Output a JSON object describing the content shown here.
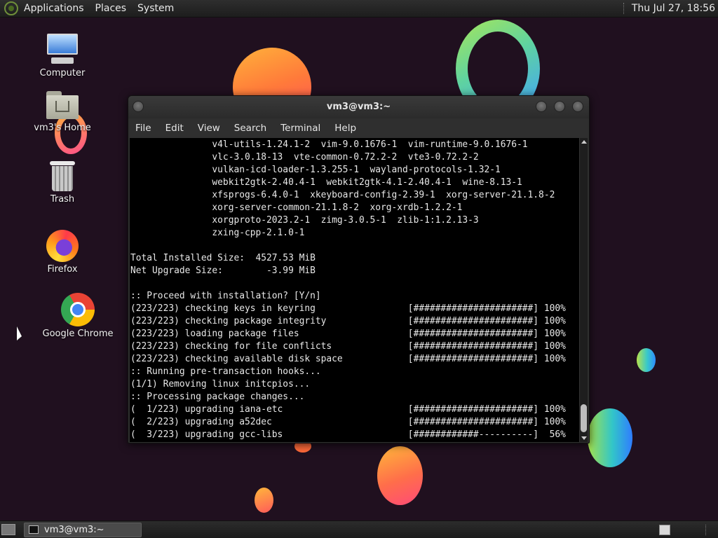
{
  "top_panel": {
    "menus": [
      "Applications",
      "Places",
      "System"
    ],
    "clock": "Thu Jul 27, 18:56"
  },
  "desktop": {
    "icons": [
      {
        "label": "Computer",
        "icon": "computer-icon"
      },
      {
        "label": "vm3's Home",
        "icon": "home-folder-icon"
      },
      {
        "label": "Trash",
        "icon": "trash-icon"
      },
      {
        "label": "Firefox",
        "icon": "firefox-icon"
      },
      {
        "label": "Google Chrome",
        "icon": "chrome-icon"
      }
    ]
  },
  "window": {
    "title": "vm3@vm3:~",
    "menus": [
      "File",
      "Edit",
      "View",
      "Search",
      "Terminal",
      "Help"
    ],
    "lines": [
      "               v4l-utils-1.24.1-2  vim-9.0.1676-1  vim-runtime-9.0.1676-1",
      "               vlc-3.0.18-13  vte-common-0.72.2-2  vte3-0.72.2-2",
      "               vulkan-icd-loader-1.3.255-1  wayland-protocols-1.32-1",
      "               webkit2gtk-2.40.4-1  webkit2gtk-4.1-2.40.4-1  wine-8.13-1",
      "               xfsprogs-6.4.0-1  xkeyboard-config-2.39-1  xorg-server-21.1.8-2",
      "               xorg-server-common-21.1.8-2  xorg-xrdb-1.2.2-1",
      "               xorgproto-2023.2-1  zimg-3.0.5-1  zlib-1:1.2.13-3",
      "               zxing-cpp-2.1.0-1",
      "",
      "Total Installed Size:  4527.53 MiB",
      "Net Upgrade Size:        -3.99 MiB",
      "",
      ":: Proceed with installation? [Y/n]",
      "(223/223) checking keys in keyring                 [######################] 100%",
      "(223/223) checking package integrity               [######################] 100%",
      "(223/223) loading package files                    [######################] 100%",
      "(223/223) checking for file conflicts              [######################] 100%",
      "(223/223) checking available disk space            [######################] 100%",
      ":: Running pre-transaction hooks...",
      "(1/1) Removing linux initcpios...",
      ":: Processing package changes...",
      "(  1/223) upgrading iana-etc                       [######################] 100%",
      "(  2/223) upgrading a52dec                         [######################] 100%",
      "(  3/223) upgrading gcc-libs                       [############----------]  56%"
    ]
  },
  "taskbar": {
    "task_label": "vm3@vm3:~"
  }
}
